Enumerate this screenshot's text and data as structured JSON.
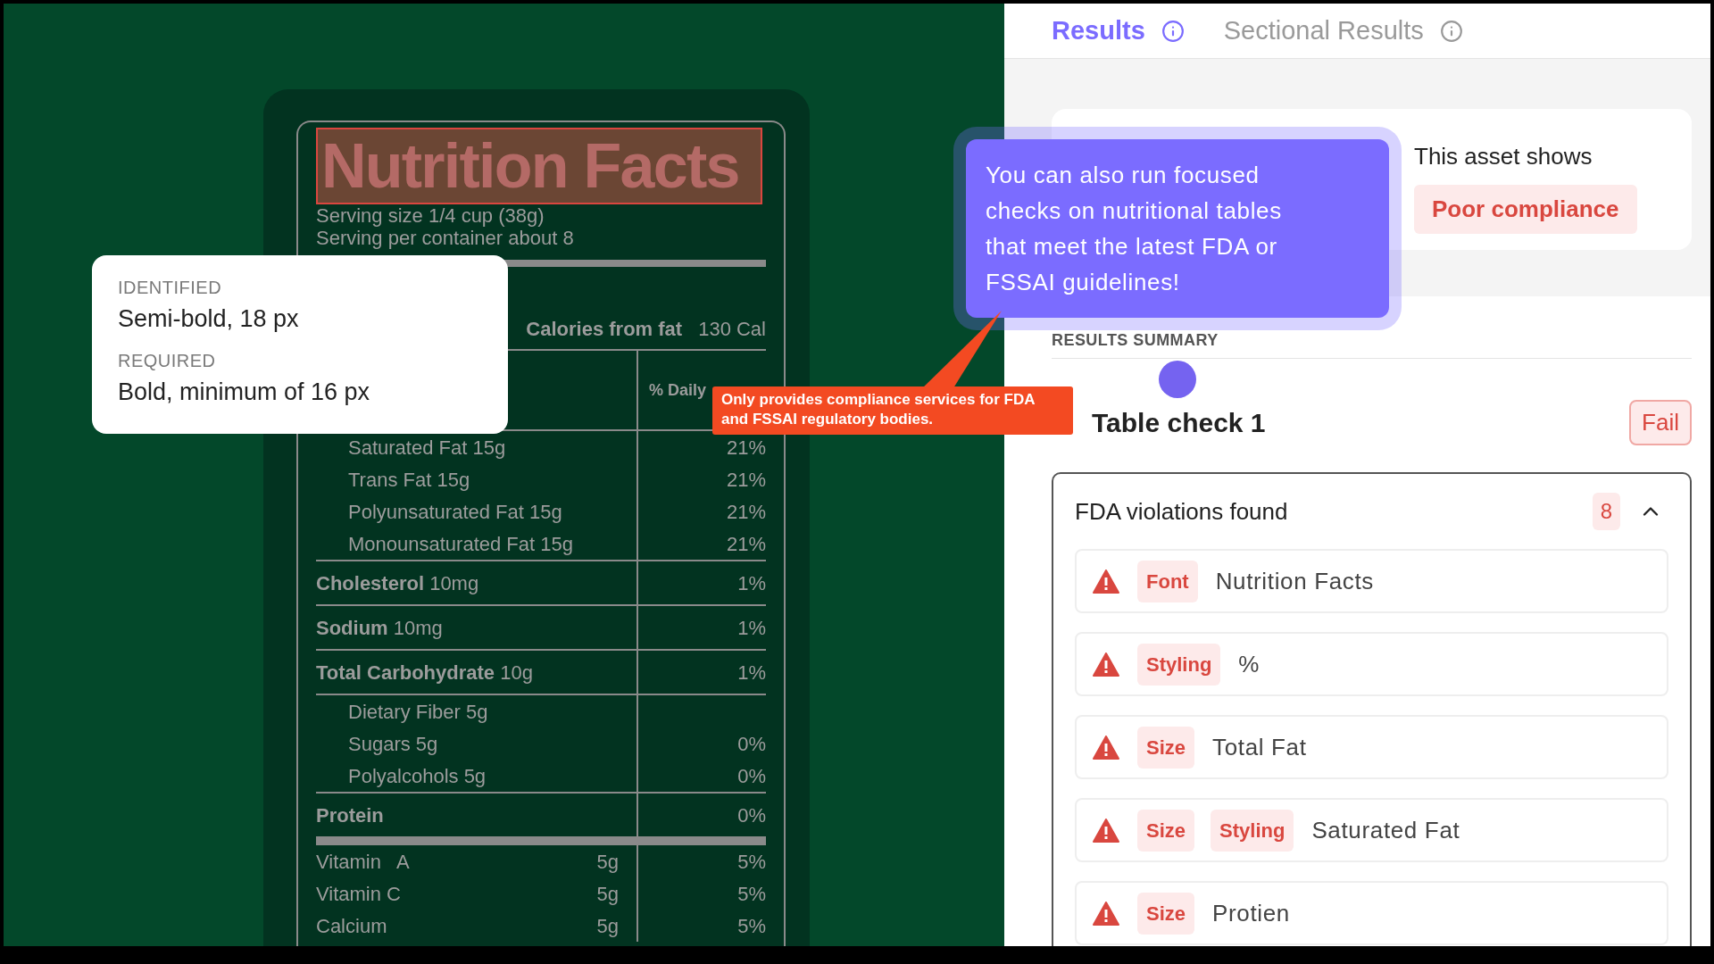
{
  "nutrition_label": {
    "title": "Nutrition Facts",
    "title_highlighted": true,
    "serving_lines": [
      "Serving size 1/4 cup (38g)",
      "Serving per container about 8"
    ],
    "calories_from_fat": {
      "label": "Calories from fat",
      "value": "130 Cal"
    },
    "daily_value_header": "% Daily",
    "rows": [
      {
        "kind": "sub",
        "name": "Saturated Fat 15g",
        "percent": "21%"
      },
      {
        "kind": "sub",
        "name": "Trans Fat 15g",
        "percent": "21%"
      },
      {
        "kind": "sub",
        "name": "Polyunsaturated Fat 15g",
        "percent": "21%"
      },
      {
        "kind": "sub",
        "name": "Monounsaturated Fat 15g",
        "percent": "21%"
      },
      {
        "kind": "main",
        "name": "Cholesterol",
        "amount": "10mg",
        "percent": "1%"
      },
      {
        "kind": "main",
        "name": "Sodium",
        "amount": "10mg",
        "percent": "1%"
      },
      {
        "kind": "main",
        "name": "Total Carbohydrate",
        "amount": "10g",
        "percent": "1%"
      },
      {
        "kind": "sub",
        "name": "Dietary Fiber 5g"
      },
      {
        "kind": "sub",
        "name": "Sugars 5g",
        "percent": "0%"
      },
      {
        "kind": "sub",
        "name": "Polyalcohols 5g",
        "percent": "0%"
      },
      {
        "kind": "main",
        "name": "Protein",
        "percent": "0%"
      },
      {
        "kind": "vitamin",
        "name": "Vitamin   A",
        "amount": "5g",
        "percent": "5%"
      },
      {
        "kind": "vitamin",
        "name": "Vitamin C",
        "amount": "5g",
        "percent": "5%"
      },
      {
        "kind": "vitamin",
        "name": "Calcium",
        "amount": "5g",
        "percent": "5%"
      }
    ]
  },
  "font_popup": {
    "fields": [
      {
        "label": "IDENTIFIED",
        "value": "Semi-bold, 18 px"
      },
      {
        "label": "REQUIRED",
        "value": "Bold, minimum of 16 px"
      }
    ]
  },
  "callout": {
    "text": "Only provides compliance services for FDA and FSSAI regulatory bodies."
  },
  "tabs": [
    {
      "label": "Results",
      "selected": true
    },
    {
      "label": "Sectional Results",
      "selected": false
    }
  ],
  "summary": {
    "text": "This asset shows",
    "badge": "Poor compliance"
  },
  "tooltip": {
    "text": "You can also run focused checks on nutritional tables that meet the latest FDA or FSSAI guidelines!"
  },
  "section_heading": "RESULTS SUMMARY",
  "table_check": {
    "title": "Table check 1",
    "status": "Fail"
  },
  "violations": {
    "title": "FDA violations found",
    "count": "8",
    "expanded": true,
    "items": [
      {
        "tags": [
          "Font"
        ],
        "text": "Nutrition Facts"
      },
      {
        "tags": [
          "Styling"
        ],
        "text": "%"
      },
      {
        "tags": [
          "Size"
        ],
        "text": "Total Fat"
      },
      {
        "tags": [
          "Size",
          "Styling"
        ],
        "text": "Saturated Fat"
      },
      {
        "tags": [
          "Size"
        ],
        "text": "Protien"
      }
    ]
  }
}
